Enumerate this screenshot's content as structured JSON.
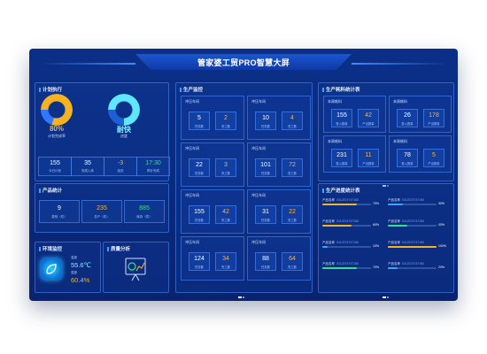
{
  "header": {
    "title": "管家婆工贸PRO智慧大屏"
  },
  "colors": {
    "accent": "#3fa2ff",
    "yellow": "#f5b324",
    "cyan": "#5ee7ff",
    "green": "#35e08a",
    "orange": "#ffb23c"
  },
  "plan": {
    "title": "计划执行",
    "gauge1": {
      "value": "80%",
      "label": "计划完成率",
      "fraction": 0.8
    },
    "gauge2": {
      "value": "耐快",
      "label": "进度",
      "fraction": 0.75
    },
    "stats": [
      {
        "value": "155",
        "label": "今日计划"
      },
      {
        "value": "35",
        "label": "完成入库"
      },
      {
        "value": "-3",
        "label": "延迟"
      },
      {
        "value": "17:30",
        "label": "预计完成"
      }
    ]
  },
  "product": {
    "title": "产品统计",
    "stats": [
      {
        "value": "9",
        "label": "类别（件）"
      },
      {
        "value": "235",
        "label": "总产（件）"
      },
      {
        "value": "885",
        "label": "库存（件）"
      }
    ]
  },
  "env": {
    "title": "环境监控",
    "temp_label": "温度",
    "temp": "55.6℃",
    "hum_label": "湿度",
    "hum": "60.4%"
  },
  "quality": {
    "title": "质量分析"
  },
  "production": {
    "title": "生产监控",
    "cells": [
      {
        "name": "冲压车间",
        "a": "5",
        "al": "任务数",
        "b": "2",
        "bl": "完工数"
      },
      {
        "name": "冲压车间",
        "a": "10",
        "al": "任务数",
        "b": "4",
        "bl": "完工数"
      },
      {
        "name": "冲压车间",
        "a": "22",
        "al": "任务数",
        "b": "3",
        "bl": "完工数"
      },
      {
        "name": "冲压车间",
        "a": "101",
        "al": "任务数",
        "b": "72",
        "bl": "完工数"
      },
      {
        "name": "冲压车间",
        "a": "155",
        "al": "任务数",
        "b": "42",
        "bl": "完工数"
      },
      {
        "name": "冲压车间",
        "a": "31",
        "al": "任务数",
        "b": "22",
        "bl": "完工数"
      },
      {
        "name": "冲压车间",
        "a": "124",
        "al": "任务数",
        "b": "34",
        "bl": "完工数"
      },
      {
        "name": "冲压车间",
        "a": "88",
        "al": "任务数",
        "b": "64",
        "bl": "完工数"
      }
    ]
  },
  "material": {
    "title": "生产耗料统计表",
    "cells": [
      {
        "name": "本周耗料",
        "tag": "",
        "a": "155",
        "al": "投入数量",
        "b": "42",
        "bl": "产出数量"
      },
      {
        "name": "本周耗料",
        "tag": "",
        "a": "26",
        "al": "投入数量",
        "b": "178",
        "bl": "产出数量"
      },
      {
        "name": "本周耗料",
        "tag": "",
        "a": "231",
        "al": "投入数量",
        "b": "11",
        "bl": "产出数量"
      },
      {
        "name": "本周耗料",
        "tag": "",
        "a": "78",
        "al": "投入数量",
        "b": "5",
        "bl": "产出数量"
      }
    ]
  },
  "progress": {
    "title": "生产进度统计表",
    "rows": [
      {
        "name": "产品名称",
        "code": "0112374747150",
        "pct": "70%",
        "fraction": 0.7,
        "color": "#f5b324"
      },
      {
        "name": "产品名称",
        "code": "0112374747150",
        "pct": "30%",
        "fraction": 0.3,
        "color": "#3fa2ff"
      },
      {
        "name": "产品名称",
        "code": "0112374747150",
        "pct": "60%",
        "fraction": 0.6,
        "color": "#f5b324"
      },
      {
        "name": "产品名称",
        "code": "0112374747150",
        "pct": "40%",
        "fraction": 0.4,
        "color": "#35e08a"
      },
      {
        "name": "产品名称",
        "code": "0112374747150",
        "pct": "10%",
        "fraction": 0.1,
        "color": "#3fa2ff"
      },
      {
        "name": "产品名称",
        "code": "0112374747150",
        "pct": "100%",
        "fraction": 1.0,
        "color": "#f5b324"
      },
      {
        "name": "产品名称",
        "code": "0112374747150",
        "pct": "70%",
        "fraction": 0.7,
        "color": "#35e08a"
      },
      {
        "name": "产品名称",
        "code": "0112374747150",
        "pct": "20%",
        "fraction": 0.2,
        "color": "#3fa2ff"
      }
    ]
  }
}
